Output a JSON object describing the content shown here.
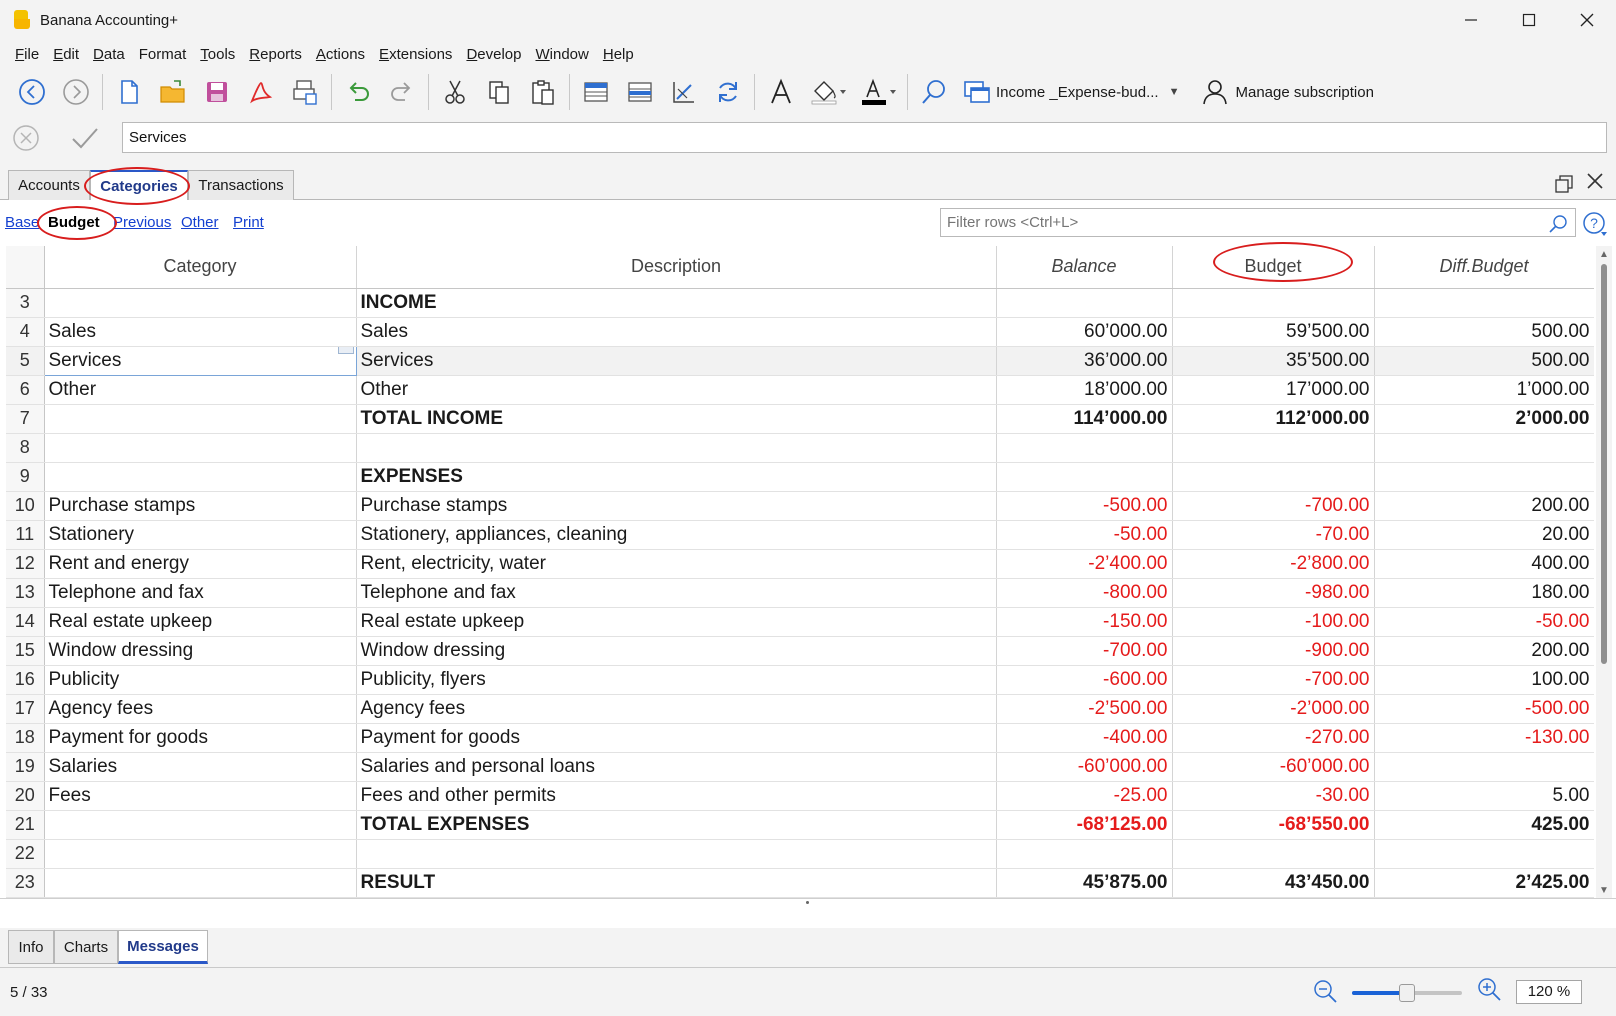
{
  "window": {
    "title": "Banana Accounting+"
  },
  "menu": [
    {
      "label": "File",
      "key": "F",
      "rest": "ile"
    },
    {
      "label": "Edit",
      "key": "E",
      "rest": "dit"
    },
    {
      "label": "Data",
      "key": "D",
      "rest": "ata"
    },
    {
      "label": "Format",
      "key": "",
      "rest": "Format"
    },
    {
      "label": "Tools",
      "key": "T",
      "rest": "ools"
    },
    {
      "label": "Reports",
      "key": "R",
      "rest": "eports"
    },
    {
      "label": "Actions",
      "key": "A",
      "rest": "ctions"
    },
    {
      "label": "Extensions",
      "key": "E",
      "rest": "xtensions"
    },
    {
      "label": "Develop",
      "key": "D",
      "rest": "evelop"
    },
    {
      "label": "Window",
      "key": "W",
      "rest": "indow"
    },
    {
      "label": "Help",
      "key": "H",
      "rest": "elp"
    }
  ],
  "toolbar": {
    "document_name": "Income _Expense-bud...",
    "manage_subscription": "Manage subscription"
  },
  "editbar": {
    "value": "Services"
  },
  "doc_tabs": [
    "Accounts",
    "Categories",
    "Transactions"
  ],
  "active_doc_tab": "Categories",
  "views": {
    "base": "Base",
    "budget": "Budget",
    "previous": "Previous",
    "other": "Other",
    "print": "Print"
  },
  "filter": {
    "placeholder": "Filter rows <Ctrl+L>"
  },
  "table": {
    "columns": [
      "Category",
      "Description",
      "Balance",
      "Budget",
      "Diff.Budget"
    ],
    "rows": [
      {
        "n": "3",
        "category": "",
        "description": "INCOME",
        "balance": "",
        "budget": "",
        "diff": "",
        "bold": true
      },
      {
        "n": "4",
        "category": "Sales",
        "description": "Sales",
        "balance": "60’000.00",
        "budget": "59’500.00",
        "diff": "500.00"
      },
      {
        "n": "5",
        "category": "Services",
        "description": "Services",
        "balance": "36’000.00",
        "budget": "35’500.00",
        "diff": "500.00",
        "selected": true
      },
      {
        "n": "6",
        "category": "Other",
        "description": "Other",
        "balance": "18’000.00",
        "budget": "17’000.00",
        "diff": "1’000.00"
      },
      {
        "n": "7",
        "category": "",
        "description": "TOTAL INCOME",
        "balance": "114’000.00",
        "budget": "112’000.00",
        "diff": "2’000.00",
        "bold": true
      },
      {
        "n": "8",
        "category": "",
        "description": "",
        "balance": "",
        "budget": "",
        "diff": ""
      },
      {
        "n": "9",
        "category": "",
        "description": "EXPENSES",
        "balance": "",
        "budget": "",
        "diff": "",
        "bold": true
      },
      {
        "n": "10",
        "category": "Purchase stamps",
        "description": "Purchase stamps",
        "balance": "-500.00",
        "budget": "-700.00",
        "diff": "200.00"
      },
      {
        "n": "11",
        "category": "Stationery",
        "description": "Stationery, appliances, cleaning",
        "balance": "-50.00",
        "budget": "-70.00",
        "diff": "20.00"
      },
      {
        "n": "12",
        "category": "Rent and energy",
        "description": "Rent, electricity, water",
        "balance": "-2’400.00",
        "budget": "-2’800.00",
        "diff": "400.00"
      },
      {
        "n": "13",
        "category": "Telephone and fax",
        "description": "Telephone and fax",
        "balance": "-800.00",
        "budget": "-980.00",
        "diff": "180.00"
      },
      {
        "n": "14",
        "category": "Real estate upkeep",
        "description": "Real estate upkeep",
        "balance": "-150.00",
        "budget": "-100.00",
        "diff": "-50.00"
      },
      {
        "n": "15",
        "category": "Window dressing",
        "description": "Window dressing",
        "balance": "-700.00",
        "budget": "-900.00",
        "diff": "200.00"
      },
      {
        "n": "16",
        "category": "Publicity",
        "description": "Publicity, flyers",
        "balance": "-600.00",
        "budget": "-700.00",
        "diff": "100.00"
      },
      {
        "n": "17",
        "category": "Agency fees",
        "description": "Agency fees",
        "balance": "-2’500.00",
        "budget": "-2’000.00",
        "diff": "-500.00"
      },
      {
        "n": "18",
        "category": "Payment for goods",
        "description": "Payment for goods",
        "balance": "-400.00",
        "budget": "-270.00",
        "diff": "-130.00"
      },
      {
        "n": "19",
        "category": "Salaries",
        "description": "Salaries and personal loans",
        "balance": "-60’000.00",
        "budget": "-60’000.00",
        "diff": ""
      },
      {
        "n": "20",
        "category": "Fees",
        "description": "Fees and other permits",
        "balance": "-25.00",
        "budget": "-30.00",
        "diff": "5.00"
      },
      {
        "n": "21",
        "category": "",
        "description": "TOTAL EXPENSES",
        "balance": "-68’125.00",
        "budget": "-68’550.00",
        "diff": "425.00",
        "bold": true
      },
      {
        "n": "22",
        "category": "",
        "description": "",
        "balance": "",
        "budget": "",
        "diff": ""
      },
      {
        "n": "23",
        "category": "",
        "description": "RESULT",
        "balance": "45’875.00",
        "budget": "43’450.00",
        "diff": "2’425.00",
        "bold": true
      }
    ]
  },
  "info_tabs": [
    "Info",
    "Charts",
    "Messages"
  ],
  "active_info_tab": "Messages",
  "status": {
    "position": "5 / 33",
    "zoom": "120 %",
    "zoom_level_fraction": 0.5
  },
  "colors": {
    "negative": "#e51b1b",
    "accent": "#2a58c8",
    "annotation": "#d81d1d"
  }
}
